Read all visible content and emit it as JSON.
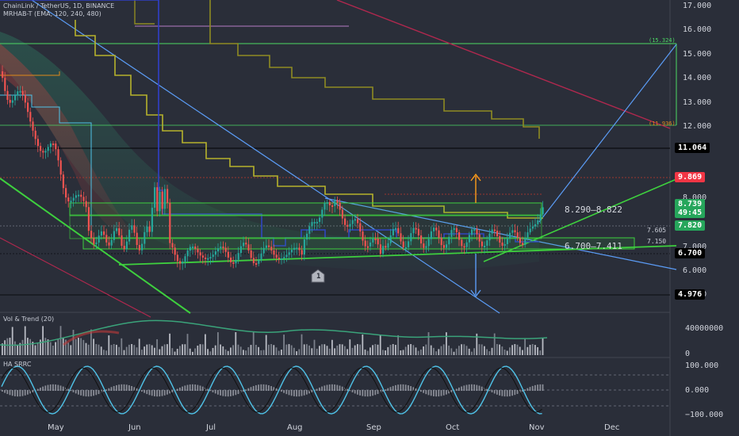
{
  "header": {
    "symbol_line": "ChainLink / TetherUS, 1D, BINANCE",
    "indicator_line": "MRHAB-T (EMA, 120, 240, 480)"
  },
  "panes": {
    "volume_title": "Vol & Trend (20)",
    "oscillator_title": "HA SRRC"
  },
  "price_axis": {
    "labels": [
      "17.000",
      "16.000",
      "15.000",
      "14.000",
      "13.000",
      "12.000",
      "8.000",
      "7.000",
      "6.000",
      "5.000"
    ]
  },
  "volume_axis": {
    "labels": [
      "40000000",
      "0"
    ]
  },
  "oscillator_axis": {
    "labels": [
      "100.000",
      "0.000",
      "−100.000"
    ]
  },
  "time_axis": {
    "labels": [
      "May",
      "Jun",
      "Jul",
      "Aug",
      "Sep",
      "Oct",
      "Nov",
      "Dec"
    ]
  },
  "price_tags": {
    "level_11": "11.064",
    "level_9": "9.869",
    "last_price": "8.739",
    "countdown": "49:45",
    "level_7_8": "7.820",
    "level_6_7": "6.700",
    "level_5": "4.976"
  },
  "chart_labels": {
    "upper_zone": "8.290–8.822",
    "lower_zone": "6.700–7.411",
    "mini_7605": "7.605",
    "mini_7150": "7.150",
    "fib_high": "(15.324)",
    "fib_mid": "(11.936)",
    "marker": "1"
  },
  "colors": {
    "background": "#2a2e39",
    "red_tag": "#f23645",
    "green_tag": "#26a65b",
    "black_tag": "#000000",
    "trendline_blue": "#5b9cf6",
    "support_green": "#3ed03e"
  }
}
